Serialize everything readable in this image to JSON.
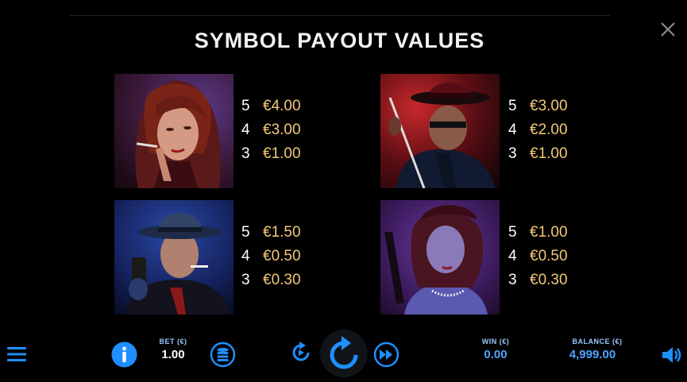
{
  "title": "SYMBOL PAYOUT VALUES",
  "accent_color": "#1e8fff",
  "payout_color": "#f3c978",
  "symbols": [
    {
      "name": "red-haired-woman",
      "payouts": [
        {
          "count": "5",
          "amount": "€4.00"
        },
        {
          "count": "4",
          "amount": "€3.00"
        },
        {
          "count": "3",
          "amount": "€1.00"
        }
      ]
    },
    {
      "name": "gangster-with-cane",
      "payouts": [
        {
          "count": "5",
          "amount": "€3.00"
        },
        {
          "count": "4",
          "amount": "€2.00"
        },
        {
          "count": "3",
          "amount": "€1.00"
        }
      ]
    },
    {
      "name": "gangster-with-gun",
      "payouts": [
        {
          "count": "5",
          "amount": "€1.50"
        },
        {
          "count": "4",
          "amount": "€0.50"
        },
        {
          "count": "3",
          "amount": "€0.30"
        }
      ]
    },
    {
      "name": "woman-with-pearls",
      "payouts": [
        {
          "count": "5",
          "amount": "€1.00"
        },
        {
          "count": "4",
          "amount": "€0.50"
        },
        {
          "count": "3",
          "amount": "€0.30"
        }
      ]
    }
  ],
  "bottom_bar": {
    "bet_label": "BET (€)",
    "bet_value": "1.00",
    "win_label": "WIN (€)",
    "win_value": "0.00",
    "balance_label": "BALANCE (€)",
    "balance_value": "4,999.00",
    "icons": [
      "menu-icon",
      "info-icon",
      "coin-stack-icon",
      "autoplay-icon",
      "spin-icon",
      "fast-forward-icon",
      "speaker-icon",
      "close-icon"
    ]
  }
}
